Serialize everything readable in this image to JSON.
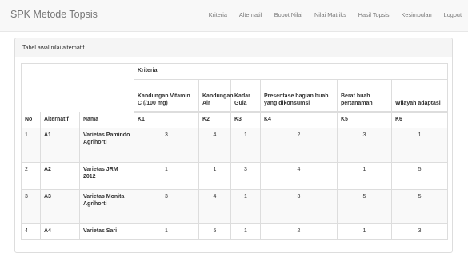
{
  "navbar": {
    "brand": "SPK Metode Topsis",
    "items": [
      "Kriteria",
      "Alternatif",
      "Bobot Nilai",
      "Nilai Matriks",
      "Hasil Topsis",
      "Kesimpulan",
      "Logout"
    ]
  },
  "panel": {
    "title": "Tabel awal nilai alternatif"
  },
  "table": {
    "group_header": "Kriteria",
    "col_no": "No",
    "col_alternatif": "Alternatif",
    "col_nama": "Nama",
    "criteria_names": [
      "Kandungan Vitamin C (/100 mg)",
      "Kandungan Air",
      "Kadar Gula",
      "Presentase bagian buah yang dikonsumsi",
      "Berat buah pertanaman",
      "Wilayah adaptasi"
    ],
    "criteria_codes": [
      "K1",
      "K2",
      "K3",
      "K4",
      "K5",
      "K6"
    ],
    "rows": [
      {
        "no": "1",
        "alt": "A1",
        "nama": "Varietas Pamindo Agrihorti",
        "values": [
          "3",
          "4",
          "1",
          "2",
          "3",
          "1"
        ]
      },
      {
        "no": "2",
        "alt": "A2",
        "nama": "Varietas JRM 2012",
        "values": [
          "1",
          "1",
          "3",
          "4",
          "1",
          "5"
        ]
      },
      {
        "no": "3",
        "alt": "A3",
        "nama": "Varietas Monita Agrihorti",
        "values": [
          "3",
          "4",
          "1",
          "3",
          "5",
          "5"
        ]
      },
      {
        "no": "4",
        "alt": "A4",
        "nama": "Varietas Sari",
        "values": [
          "1",
          "5",
          "1",
          "2",
          "1",
          "3"
        ]
      }
    ]
  }
}
